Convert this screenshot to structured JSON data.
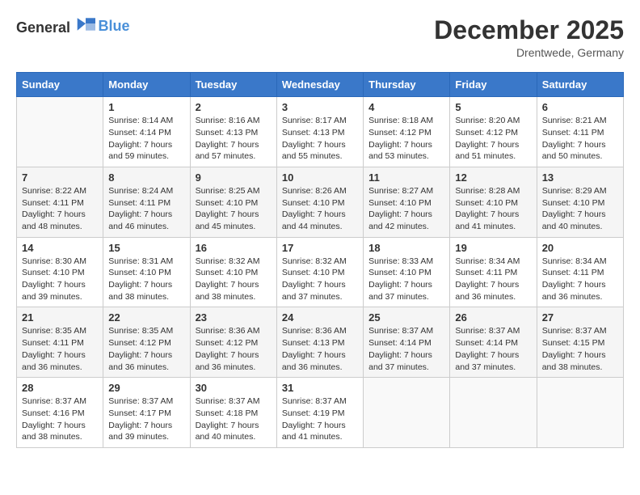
{
  "header": {
    "logo_general": "General",
    "logo_blue": "Blue",
    "month_title": "December 2025",
    "location": "Drentwede, Germany"
  },
  "weekdays": [
    "Sunday",
    "Monday",
    "Tuesday",
    "Wednesday",
    "Thursday",
    "Friday",
    "Saturday"
  ],
  "weeks": [
    [
      {
        "day": "",
        "sunrise": "",
        "sunset": "",
        "daylight": ""
      },
      {
        "day": "1",
        "sunrise": "Sunrise: 8:14 AM",
        "sunset": "Sunset: 4:14 PM",
        "daylight": "Daylight: 7 hours and 59 minutes."
      },
      {
        "day": "2",
        "sunrise": "Sunrise: 8:16 AM",
        "sunset": "Sunset: 4:13 PM",
        "daylight": "Daylight: 7 hours and 57 minutes."
      },
      {
        "day": "3",
        "sunrise": "Sunrise: 8:17 AM",
        "sunset": "Sunset: 4:13 PM",
        "daylight": "Daylight: 7 hours and 55 minutes."
      },
      {
        "day": "4",
        "sunrise": "Sunrise: 8:18 AM",
        "sunset": "Sunset: 4:12 PM",
        "daylight": "Daylight: 7 hours and 53 minutes."
      },
      {
        "day": "5",
        "sunrise": "Sunrise: 8:20 AM",
        "sunset": "Sunset: 4:12 PM",
        "daylight": "Daylight: 7 hours and 51 minutes."
      },
      {
        "day": "6",
        "sunrise": "Sunrise: 8:21 AM",
        "sunset": "Sunset: 4:11 PM",
        "daylight": "Daylight: 7 hours and 50 minutes."
      }
    ],
    [
      {
        "day": "7",
        "sunrise": "Sunrise: 8:22 AM",
        "sunset": "Sunset: 4:11 PM",
        "daylight": "Daylight: 7 hours and 48 minutes."
      },
      {
        "day": "8",
        "sunrise": "Sunrise: 8:24 AM",
        "sunset": "Sunset: 4:11 PM",
        "daylight": "Daylight: 7 hours and 46 minutes."
      },
      {
        "day": "9",
        "sunrise": "Sunrise: 8:25 AM",
        "sunset": "Sunset: 4:10 PM",
        "daylight": "Daylight: 7 hours and 45 minutes."
      },
      {
        "day": "10",
        "sunrise": "Sunrise: 8:26 AM",
        "sunset": "Sunset: 4:10 PM",
        "daylight": "Daylight: 7 hours and 44 minutes."
      },
      {
        "day": "11",
        "sunrise": "Sunrise: 8:27 AM",
        "sunset": "Sunset: 4:10 PM",
        "daylight": "Daylight: 7 hours and 42 minutes."
      },
      {
        "day": "12",
        "sunrise": "Sunrise: 8:28 AM",
        "sunset": "Sunset: 4:10 PM",
        "daylight": "Daylight: 7 hours and 41 minutes."
      },
      {
        "day": "13",
        "sunrise": "Sunrise: 8:29 AM",
        "sunset": "Sunset: 4:10 PM",
        "daylight": "Daylight: 7 hours and 40 minutes."
      }
    ],
    [
      {
        "day": "14",
        "sunrise": "Sunrise: 8:30 AM",
        "sunset": "Sunset: 4:10 PM",
        "daylight": "Daylight: 7 hours and 39 minutes."
      },
      {
        "day": "15",
        "sunrise": "Sunrise: 8:31 AM",
        "sunset": "Sunset: 4:10 PM",
        "daylight": "Daylight: 7 hours and 38 minutes."
      },
      {
        "day": "16",
        "sunrise": "Sunrise: 8:32 AM",
        "sunset": "Sunset: 4:10 PM",
        "daylight": "Daylight: 7 hours and 38 minutes."
      },
      {
        "day": "17",
        "sunrise": "Sunrise: 8:32 AM",
        "sunset": "Sunset: 4:10 PM",
        "daylight": "Daylight: 7 hours and 37 minutes."
      },
      {
        "day": "18",
        "sunrise": "Sunrise: 8:33 AM",
        "sunset": "Sunset: 4:10 PM",
        "daylight": "Daylight: 7 hours and 37 minutes."
      },
      {
        "day": "19",
        "sunrise": "Sunrise: 8:34 AM",
        "sunset": "Sunset: 4:11 PM",
        "daylight": "Daylight: 7 hours and 36 minutes."
      },
      {
        "day": "20",
        "sunrise": "Sunrise: 8:34 AM",
        "sunset": "Sunset: 4:11 PM",
        "daylight": "Daylight: 7 hours and 36 minutes."
      }
    ],
    [
      {
        "day": "21",
        "sunrise": "Sunrise: 8:35 AM",
        "sunset": "Sunset: 4:11 PM",
        "daylight": "Daylight: 7 hours and 36 minutes."
      },
      {
        "day": "22",
        "sunrise": "Sunrise: 8:35 AM",
        "sunset": "Sunset: 4:12 PM",
        "daylight": "Daylight: 7 hours and 36 minutes."
      },
      {
        "day": "23",
        "sunrise": "Sunrise: 8:36 AM",
        "sunset": "Sunset: 4:12 PM",
        "daylight": "Daylight: 7 hours and 36 minutes."
      },
      {
        "day": "24",
        "sunrise": "Sunrise: 8:36 AM",
        "sunset": "Sunset: 4:13 PM",
        "daylight": "Daylight: 7 hours and 36 minutes."
      },
      {
        "day": "25",
        "sunrise": "Sunrise: 8:37 AM",
        "sunset": "Sunset: 4:14 PM",
        "daylight": "Daylight: 7 hours and 37 minutes."
      },
      {
        "day": "26",
        "sunrise": "Sunrise: 8:37 AM",
        "sunset": "Sunset: 4:14 PM",
        "daylight": "Daylight: 7 hours and 37 minutes."
      },
      {
        "day": "27",
        "sunrise": "Sunrise: 8:37 AM",
        "sunset": "Sunset: 4:15 PM",
        "daylight": "Daylight: 7 hours and 38 minutes."
      }
    ],
    [
      {
        "day": "28",
        "sunrise": "Sunrise: 8:37 AM",
        "sunset": "Sunset: 4:16 PM",
        "daylight": "Daylight: 7 hours and 38 minutes."
      },
      {
        "day": "29",
        "sunrise": "Sunrise: 8:37 AM",
        "sunset": "Sunset: 4:17 PM",
        "daylight": "Daylight: 7 hours and 39 minutes."
      },
      {
        "day": "30",
        "sunrise": "Sunrise: 8:37 AM",
        "sunset": "Sunset: 4:18 PM",
        "daylight": "Daylight: 7 hours and 40 minutes."
      },
      {
        "day": "31",
        "sunrise": "Sunrise: 8:37 AM",
        "sunset": "Sunset: 4:19 PM",
        "daylight": "Daylight: 7 hours and 41 minutes."
      },
      {
        "day": "",
        "sunrise": "",
        "sunset": "",
        "daylight": ""
      },
      {
        "day": "",
        "sunrise": "",
        "sunset": "",
        "daylight": ""
      },
      {
        "day": "",
        "sunrise": "",
        "sunset": "",
        "daylight": ""
      }
    ]
  ]
}
